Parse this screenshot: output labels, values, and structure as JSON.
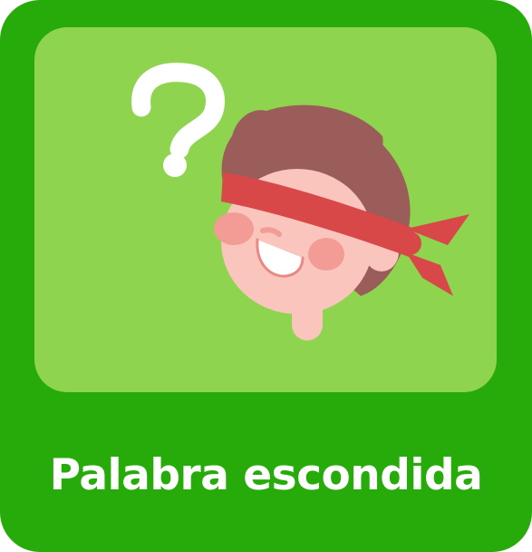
{
  "tile": {
    "label": "Palabra escondida",
    "icon": "blindfolded-boy-question-mark",
    "colors": {
      "tile_background": "#26ab0a",
      "panel_background": "#8fd44e",
      "label_text": "#ffffff",
      "hair": "#9a5d5a",
      "skin": "#f9c5bd",
      "blindfold": "#d94848",
      "cheeks": "#f29c95",
      "question_mark": "#ffffff"
    }
  }
}
